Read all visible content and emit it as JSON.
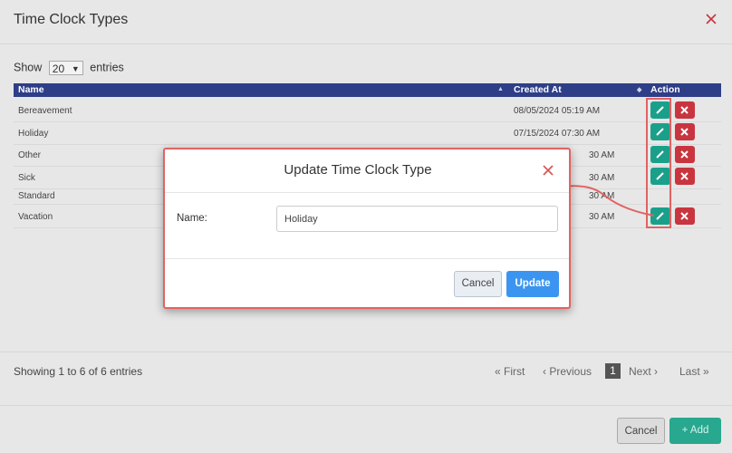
{
  "background": {
    "title": "Time Clock Types",
    "show_label": "Show",
    "entries_value": "20",
    "entries_label": "entries",
    "columns": {
      "name": "Name",
      "created_at": "Created At",
      "action": "Action"
    },
    "rows": [
      {
        "name": "Bereavement",
        "created": "08/05/2024 05:19 AM"
      },
      {
        "name": "Holiday",
        "created": "07/15/2024 07:30 AM"
      },
      {
        "name": "Other",
        "created": "30 AM"
      },
      {
        "name": "Sick",
        "created": "30 AM"
      },
      {
        "name": "Standard",
        "created": "30 AM"
      },
      {
        "name": "Vacation",
        "created": "30 AM"
      }
    ],
    "showing": "Showing 1 to 6 of 6 entries",
    "pager": {
      "first": "« First",
      "previous": "‹ Previous",
      "page": "1",
      "next": "Next ›",
      "last": "Last »"
    },
    "cancel": "Cancel",
    "add": "+ Add"
  },
  "dialog": {
    "title": "Update Time Clock Type",
    "name_label": "Name:",
    "name_value": "Holiday",
    "cancel": "Cancel",
    "update": "Update"
  },
  "colors": {
    "header": "#2e3e87",
    "edit": "#1aa08a",
    "delete": "#c9353f",
    "primary": "#3b95f0",
    "highlight": "#e26262"
  }
}
